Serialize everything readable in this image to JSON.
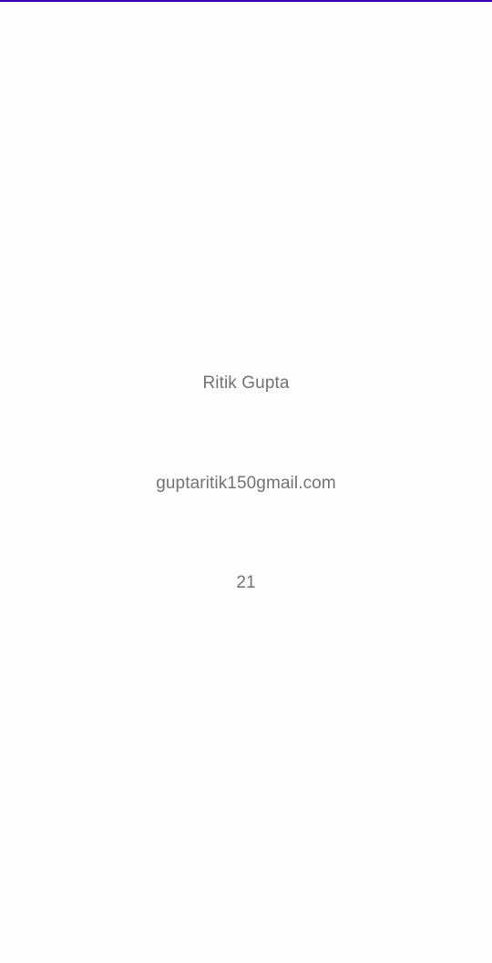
{
  "colors": {
    "accent": "#3700b3",
    "text": "#737373",
    "background": "#fefefe"
  },
  "profile": {
    "name": "Ritik Gupta",
    "email": "guptaritik150gmail.com",
    "age": "21"
  }
}
